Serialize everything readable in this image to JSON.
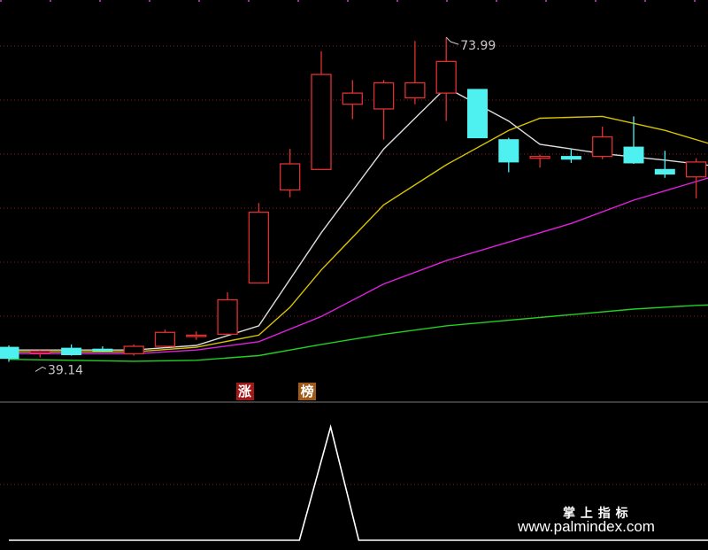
{
  "watermark": {
    "title": "掌 上 指 标",
    "url": "www.palmindex.com"
  },
  "tags": [
    {
      "label": "涨",
      "bg": "#a01818",
      "fg": "#ffffff"
    },
    {
      "label": "榜",
      "bg": "#a05a18",
      "fg": "#ffffff"
    }
  ],
  "colors": {
    "up": "#e03030",
    "down": "#4ff0f0",
    "ma_white": "#dcdcdc",
    "ma_yellow": "#d8c400",
    "ma_magenta": "#e020e0",
    "ma_green": "#22d022",
    "grid": "#8a1a1a",
    "axis": "#d0d0d0",
    "label": "#c8c8c8",
    "indicator": "#ffffff"
  },
  "chart_data": {
    "type": "candlestick",
    "ylim": [
      35.0,
      78.0
    ],
    "high_label": "73.99",
    "low_label": "39.14",
    "candles": [
      {
        "o": 40.7,
        "h": 40.9,
        "l": 39.14,
        "c": 39.5
      },
      {
        "o": 40.1,
        "h": 40.4,
        "l": 39.6,
        "c": 40.3
      },
      {
        "o": 40.6,
        "h": 41.0,
        "l": 39.8,
        "c": 39.9
      },
      {
        "o": 40.5,
        "h": 40.8,
        "l": 40.2,
        "c": 40.3
      },
      {
        "o": 40.0,
        "h": 41.0,
        "l": 39.8,
        "c": 40.8
      },
      {
        "o": 40.8,
        "h": 42.6,
        "l": 40.7,
        "c": 42.3
      },
      {
        "o": 42.0,
        "h": 42.4,
        "l": 41.5,
        "c": 42.0
      },
      {
        "o": 42.1,
        "h": 46.6,
        "l": 42.0,
        "c": 45.8
      },
      {
        "o": 47.6,
        "h": 56.2,
        "l": 47.6,
        "c": 55.2
      },
      {
        "o": 57.6,
        "h": 62.0,
        "l": 56.8,
        "c": 60.4
      },
      {
        "o": 59.8,
        "h": 72.5,
        "l": 59.8,
        "c": 70.0
      },
      {
        "o": 66.8,
        "h": 69.4,
        "l": 65.2,
        "c": 68.0
      },
      {
        "o": 66.3,
        "h": 69.4,
        "l": 63.0,
        "c": 69.1
      },
      {
        "o": 67.5,
        "h": 73.6,
        "l": 66.8,
        "c": 69.1
      },
      {
        "o": 68.0,
        "h": 73.99,
        "l": 65.0,
        "c": 71.4
      },
      {
        "o": 68.4,
        "h": 68.4,
        "l": 63.2,
        "c": 63.2
      },
      {
        "o": 63.0,
        "h": 63.2,
        "l": 59.5,
        "c": 60.6
      },
      {
        "o": 61.0,
        "h": 61.4,
        "l": 60.0,
        "c": 61.2
      },
      {
        "o": 61.2,
        "h": 62.0,
        "l": 60.5,
        "c": 60.9
      },
      {
        "o": 61.2,
        "h": 64.4,
        "l": 60.9,
        "c": 63.3
      },
      {
        "o": 62.2,
        "h": 65.5,
        "l": 60.4,
        "c": 60.5
      },
      {
        "o": 59.8,
        "h": 61.8,
        "l": 58.9,
        "c": 59.3
      },
      {
        "o": 59.0,
        "h": 61.0,
        "l": 56.7,
        "c": 60.6
      }
    ],
    "ma_white": [
      [
        0,
        40.4
      ],
      [
        4,
        40.4
      ],
      [
        6,
        40.9
      ],
      [
        8,
        43.0
      ],
      [
        10,
        53.0
      ],
      [
        12,
        62.0
      ],
      [
        14,
        68.6
      ],
      [
        16,
        65.0
      ],
      [
        17,
        62.5
      ],
      [
        19,
        61.5
      ],
      [
        21,
        60.8
      ],
      [
        23,
        60.0
      ]
    ],
    "ma_yellow": [
      [
        0,
        40.2
      ],
      [
        4,
        40.2
      ],
      [
        6,
        40.7
      ],
      [
        8,
        42.0
      ],
      [
        9,
        45.0
      ],
      [
        10,
        49.0
      ],
      [
        12,
        56.0
      ],
      [
        14,
        60.3
      ],
      [
        16,
        64.0
      ],
      [
        17,
        65.3
      ],
      [
        19,
        65.5
      ],
      [
        21,
        64.0
      ],
      [
        23,
        62.0
      ]
    ],
    "ma_magenta": [
      [
        0,
        40.0
      ],
      [
        4,
        40.0
      ],
      [
        6,
        40.4
      ],
      [
        8,
        41.3
      ],
      [
        10,
        44.0
      ],
      [
        12,
        47.5
      ],
      [
        14,
        50.0
      ],
      [
        16,
        52.0
      ],
      [
        18,
        54.0
      ],
      [
        20,
        56.5
      ],
      [
        22,
        58.5
      ],
      [
        23,
        59.5
      ]
    ],
    "ma_green": [
      [
        0,
        39.4
      ],
      [
        4,
        39.2
      ],
      [
        6,
        39.3
      ],
      [
        8,
        39.8
      ],
      [
        10,
        41.0
      ],
      [
        12,
        42.1
      ],
      [
        14,
        43.0
      ],
      [
        16,
        43.6
      ],
      [
        18,
        44.2
      ],
      [
        20,
        44.8
      ],
      [
        22,
        45.2
      ],
      [
        23,
        45.3
      ]
    ],
    "indicator": [
      [
        0,
        0
      ],
      [
        9.3,
        0
      ],
      [
        10.3,
        1
      ],
      [
        11.2,
        0
      ],
      [
        23,
        0
      ]
    ]
  }
}
